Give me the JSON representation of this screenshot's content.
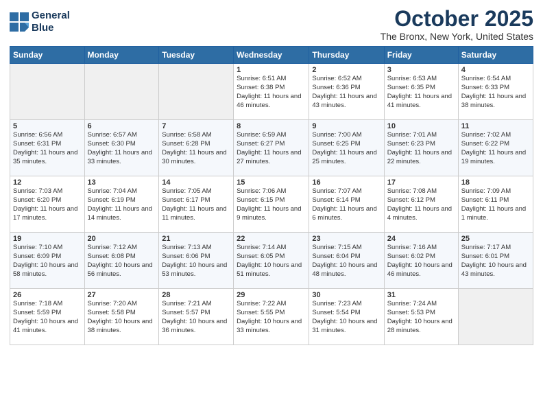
{
  "header": {
    "logo_line1": "General",
    "logo_line2": "Blue",
    "month": "October 2025",
    "location": "The Bronx, New York, United States"
  },
  "weekdays": [
    "Sunday",
    "Monday",
    "Tuesday",
    "Wednesday",
    "Thursday",
    "Friday",
    "Saturday"
  ],
  "weeks": [
    [
      {
        "day": "",
        "info": ""
      },
      {
        "day": "",
        "info": ""
      },
      {
        "day": "",
        "info": ""
      },
      {
        "day": "1",
        "info": "Sunrise: 6:51 AM\nSunset: 6:38 PM\nDaylight: 11 hours and 46 minutes."
      },
      {
        "day": "2",
        "info": "Sunrise: 6:52 AM\nSunset: 6:36 PM\nDaylight: 11 hours and 43 minutes."
      },
      {
        "day": "3",
        "info": "Sunrise: 6:53 AM\nSunset: 6:35 PM\nDaylight: 11 hours and 41 minutes."
      },
      {
        "day": "4",
        "info": "Sunrise: 6:54 AM\nSunset: 6:33 PM\nDaylight: 11 hours and 38 minutes."
      }
    ],
    [
      {
        "day": "5",
        "info": "Sunrise: 6:56 AM\nSunset: 6:31 PM\nDaylight: 11 hours and 35 minutes."
      },
      {
        "day": "6",
        "info": "Sunrise: 6:57 AM\nSunset: 6:30 PM\nDaylight: 11 hours and 33 minutes."
      },
      {
        "day": "7",
        "info": "Sunrise: 6:58 AM\nSunset: 6:28 PM\nDaylight: 11 hours and 30 minutes."
      },
      {
        "day": "8",
        "info": "Sunrise: 6:59 AM\nSunset: 6:27 PM\nDaylight: 11 hours and 27 minutes."
      },
      {
        "day": "9",
        "info": "Sunrise: 7:00 AM\nSunset: 6:25 PM\nDaylight: 11 hours and 25 minutes."
      },
      {
        "day": "10",
        "info": "Sunrise: 7:01 AM\nSunset: 6:23 PM\nDaylight: 11 hours and 22 minutes."
      },
      {
        "day": "11",
        "info": "Sunrise: 7:02 AM\nSunset: 6:22 PM\nDaylight: 11 hours and 19 minutes."
      }
    ],
    [
      {
        "day": "12",
        "info": "Sunrise: 7:03 AM\nSunset: 6:20 PM\nDaylight: 11 hours and 17 minutes."
      },
      {
        "day": "13",
        "info": "Sunrise: 7:04 AM\nSunset: 6:19 PM\nDaylight: 11 hours and 14 minutes."
      },
      {
        "day": "14",
        "info": "Sunrise: 7:05 AM\nSunset: 6:17 PM\nDaylight: 11 hours and 11 minutes."
      },
      {
        "day": "15",
        "info": "Sunrise: 7:06 AM\nSunset: 6:15 PM\nDaylight: 11 hours and 9 minutes."
      },
      {
        "day": "16",
        "info": "Sunrise: 7:07 AM\nSunset: 6:14 PM\nDaylight: 11 hours and 6 minutes."
      },
      {
        "day": "17",
        "info": "Sunrise: 7:08 AM\nSunset: 6:12 PM\nDaylight: 11 hours and 4 minutes."
      },
      {
        "day": "18",
        "info": "Sunrise: 7:09 AM\nSunset: 6:11 PM\nDaylight: 11 hours and 1 minute."
      }
    ],
    [
      {
        "day": "19",
        "info": "Sunrise: 7:10 AM\nSunset: 6:09 PM\nDaylight: 10 hours and 58 minutes."
      },
      {
        "day": "20",
        "info": "Sunrise: 7:12 AM\nSunset: 6:08 PM\nDaylight: 10 hours and 56 minutes."
      },
      {
        "day": "21",
        "info": "Sunrise: 7:13 AM\nSunset: 6:06 PM\nDaylight: 10 hours and 53 minutes."
      },
      {
        "day": "22",
        "info": "Sunrise: 7:14 AM\nSunset: 6:05 PM\nDaylight: 10 hours and 51 minutes."
      },
      {
        "day": "23",
        "info": "Sunrise: 7:15 AM\nSunset: 6:04 PM\nDaylight: 10 hours and 48 minutes."
      },
      {
        "day": "24",
        "info": "Sunrise: 7:16 AM\nSunset: 6:02 PM\nDaylight: 10 hours and 46 minutes."
      },
      {
        "day": "25",
        "info": "Sunrise: 7:17 AM\nSunset: 6:01 PM\nDaylight: 10 hours and 43 minutes."
      }
    ],
    [
      {
        "day": "26",
        "info": "Sunrise: 7:18 AM\nSunset: 5:59 PM\nDaylight: 10 hours and 41 minutes."
      },
      {
        "day": "27",
        "info": "Sunrise: 7:20 AM\nSunset: 5:58 PM\nDaylight: 10 hours and 38 minutes."
      },
      {
        "day": "28",
        "info": "Sunrise: 7:21 AM\nSunset: 5:57 PM\nDaylight: 10 hours and 36 minutes."
      },
      {
        "day": "29",
        "info": "Sunrise: 7:22 AM\nSunset: 5:55 PM\nDaylight: 10 hours and 33 minutes."
      },
      {
        "day": "30",
        "info": "Sunrise: 7:23 AM\nSunset: 5:54 PM\nDaylight: 10 hours and 31 minutes."
      },
      {
        "day": "31",
        "info": "Sunrise: 7:24 AM\nSunset: 5:53 PM\nDaylight: 10 hours and 28 minutes."
      },
      {
        "day": "",
        "info": ""
      }
    ]
  ]
}
